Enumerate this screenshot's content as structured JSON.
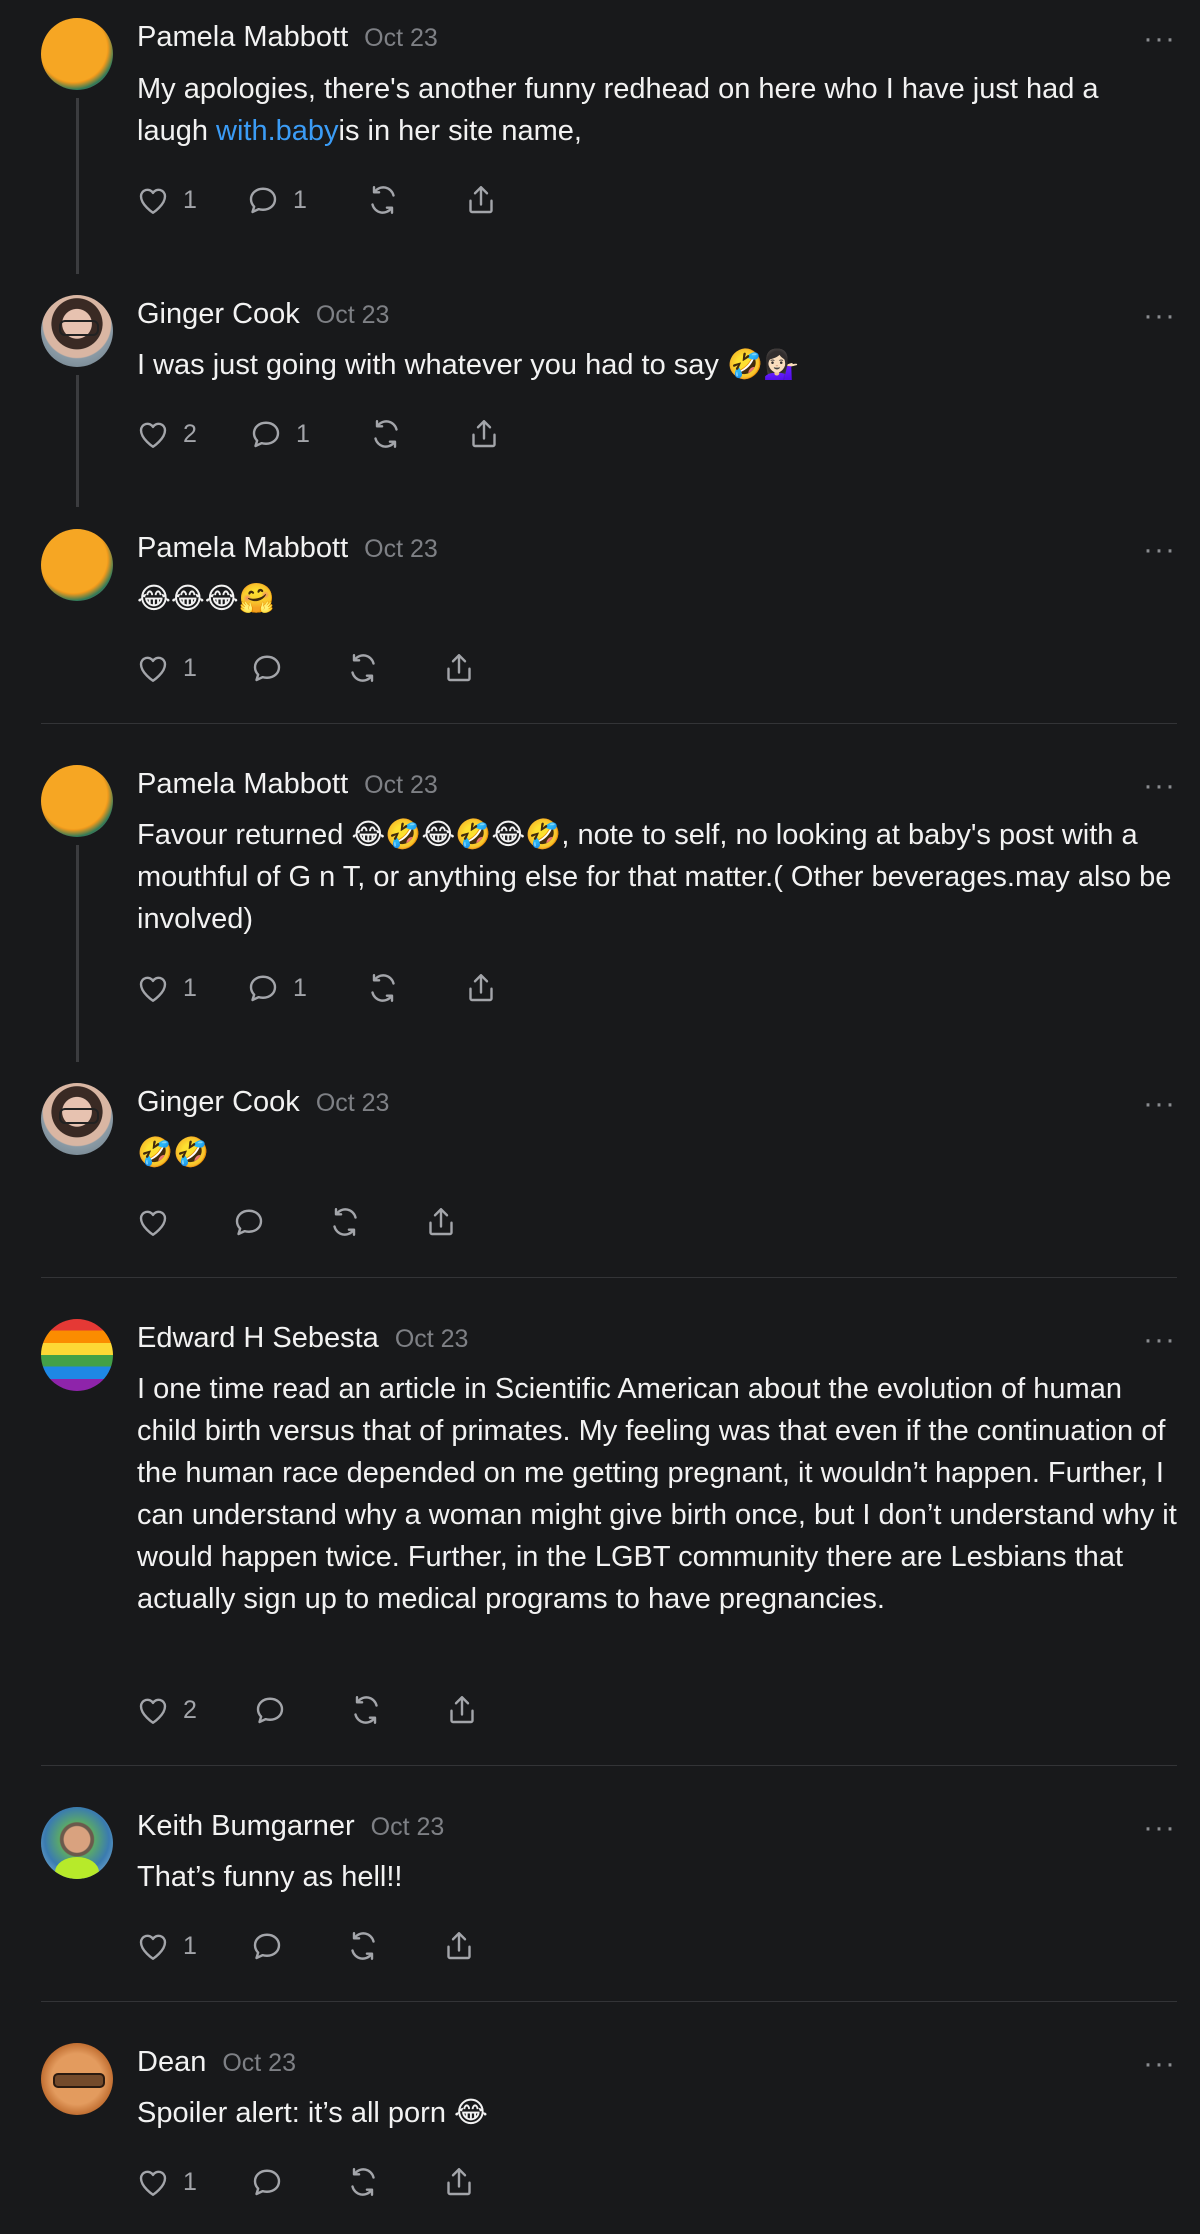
{
  "posts": [
    {
      "author": "Pamela Mabbott",
      "date": "Oct 23",
      "text_before": "My apologies, there's another funny redhead on here who I have just had a laugh ",
      "link": "with.baby",
      "text_after": "is in her site name,",
      "likes": "1",
      "replies": "1"
    },
    {
      "author": "Ginger Cook",
      "date": "Oct 23",
      "text": "I was just going with whatever you had to say 🤣💁🏻‍♀️",
      "likes": "2",
      "replies": "1"
    },
    {
      "author": "Pamela Mabbott",
      "date": "Oct 23",
      "text": "😂😂😂🤗",
      "likes": "1",
      "replies": ""
    },
    {
      "author": "Pamela Mabbott",
      "date": "Oct 23",
      "text": "Favour returned 😂🤣😂🤣😂🤣, note to self, no looking at baby's post with a mouthful of G n T, or anything else for that matter.( Other beverages.may also be involved)",
      "likes": "1",
      "replies": "1"
    },
    {
      "author": "Ginger Cook",
      "date": "Oct 23",
      "text": "🤣🤣",
      "likes": "",
      "replies": ""
    },
    {
      "author": "Edward H Sebesta",
      "date": "Oct 23",
      "text": "I one time read an article in Scientific American about the evolution of human child birth versus that of primates. My feeling was that even if the continuation of the human race depended on me getting pregnant, it wouldn’t happen. Further, I can understand why a woman might give birth once, but I don’t understand why it would happen twice. Further, in the LGBT community there are Lesbians that actually sign up to medical programs to have pregnancies.",
      "likes": "2",
      "replies": ""
    },
    {
      "author": "Keith Bumgarner",
      "date": "Oct 23",
      "text": "That’s funny as hell!!",
      "likes": "1",
      "replies": ""
    },
    {
      "author": "Dean",
      "date": "Oct 23",
      "text": "Spoiler alert: it’s all porn 😂",
      "likes": "1",
      "replies": ""
    }
  ],
  "more_label": "···",
  "icons": [
    "heart-icon",
    "comment-icon",
    "repost-icon",
    "share-icon",
    "more-icon"
  ]
}
